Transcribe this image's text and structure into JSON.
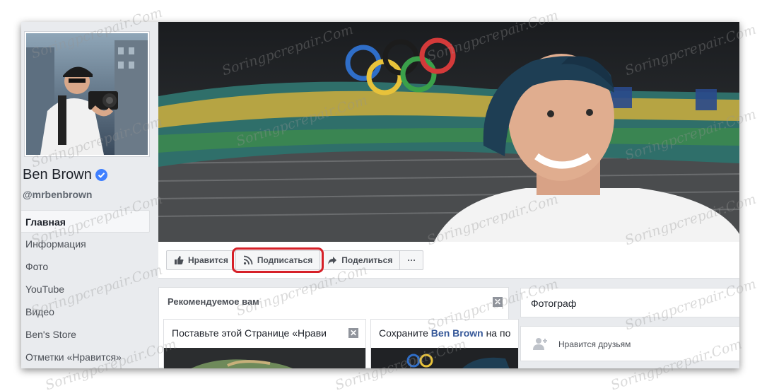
{
  "profile": {
    "name": "Ben Brown",
    "handle": "@mrbenbrown"
  },
  "nav": {
    "items": [
      {
        "label": "Главная"
      },
      {
        "label": "Информация"
      },
      {
        "label": "Фото"
      },
      {
        "label": "YouTube"
      },
      {
        "label": "Видео"
      },
      {
        "label": "Ben's Store"
      },
      {
        "label": "Отметки «Нравится»"
      }
    ]
  },
  "actions": {
    "like": "Нравится",
    "follow": "Подписаться",
    "share": "Поделиться",
    "more": "···"
  },
  "recommended": {
    "title": "Рекомендуемое вам",
    "card1_text": "Поставьте этой Странице «Нрави",
    "card2_prefix": "Сохраните ",
    "card2_name": "Ben Brown",
    "card2_suffix": " на по"
  },
  "sidebar_right": {
    "category": "Фотограф",
    "friends_like": "Нравится друзьям"
  },
  "watermark": "Soringpcrepair.Com",
  "colors": {
    "accent": "#4080ff",
    "highlight": "#d62028",
    "link": "#365899"
  }
}
